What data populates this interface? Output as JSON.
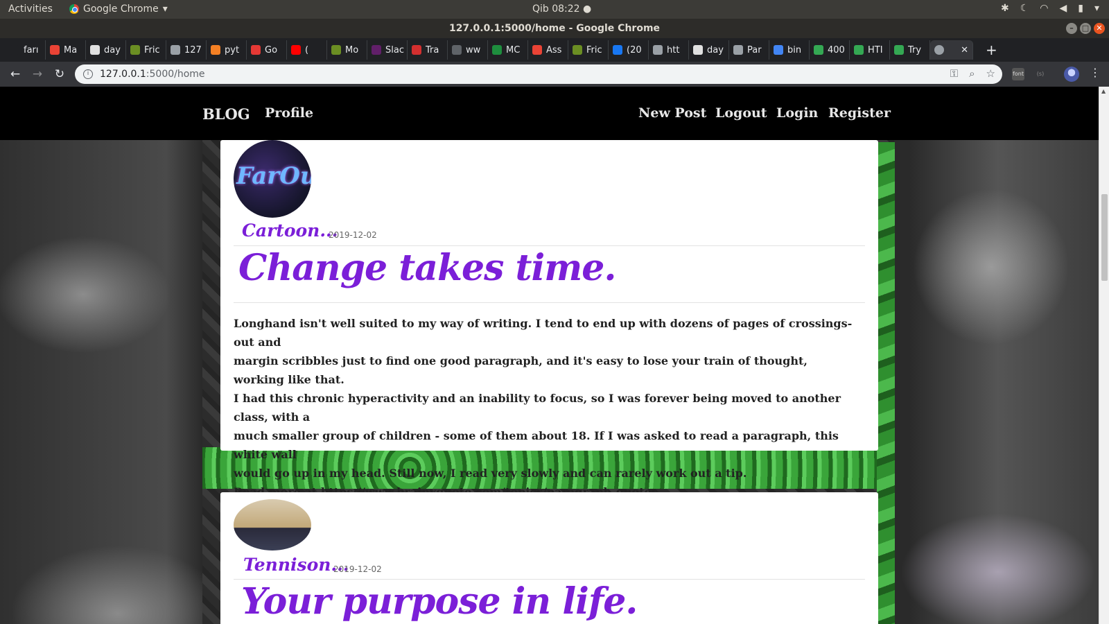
{
  "gnome": {
    "activities": "Activities",
    "app_name": "Google Chrome",
    "clock": "Qib 08:22 ●"
  },
  "window": {
    "title": "127.0.0.1:5000/home - Google Chrome"
  },
  "tabs": [
    {
      "label": "farı",
      "color": "#202124"
    },
    {
      "label": "Ma",
      "color": "#ea4335"
    },
    {
      "label": "day",
      "color": "#e0e0e0"
    },
    {
      "label": "Fric",
      "color": "#6b8e23"
    },
    {
      "label": "127",
      "color": "#9aa0a6"
    },
    {
      "label": "pyt",
      "color": "#f48024"
    },
    {
      "label": "Go",
      "color": "#e53935"
    },
    {
      "label": "(",
      "color": "#ff0000"
    },
    {
      "label": "Mo",
      "color": "#6b8e23"
    },
    {
      "label": "Slac",
      "color": "#611f69"
    },
    {
      "label": "Tra",
      "color": "#d32f2f"
    },
    {
      "label": "ww",
      "color": "#5f6368"
    },
    {
      "label": "MC",
      "color": "#1e8e3e"
    },
    {
      "label": "Ass",
      "color": "#ea4335"
    },
    {
      "label": "Fric",
      "color": "#6b8e23"
    },
    {
      "label": "(20",
      "color": "#1877f2"
    },
    {
      "label": "htt",
      "color": "#9aa0a6"
    },
    {
      "label": "day",
      "color": "#e0e0e0"
    },
    {
      "label": "Par",
      "color": "#9aa0a6"
    },
    {
      "label": "bin",
      "color": "#4285f4"
    },
    {
      "label": "400",
      "color": "#34a853"
    },
    {
      "label": "HTI",
      "color": "#34a853"
    },
    {
      "label": "Try",
      "color": "#34a853"
    }
  ],
  "active_tab": {
    "close": "✕"
  },
  "address": {
    "host": "127.0.0.1",
    "path": ":5000/home"
  },
  "extensions": {
    "font_ext": "font",
    "s_ext": "(s)"
  },
  "site_nav": {
    "brand": "BLOG",
    "profile": "Profile",
    "new_post": "New Post",
    "logout": "Logout",
    "login": "Login",
    "register": "Register"
  },
  "posts": [
    {
      "author": "Cartoon...",
      "date": "2019-12-02",
      "title": "Change takes time.",
      "content_lines": [
        "Longhand isn't well suited to my way of writing. I tend to end up with dozens of pages of crossings-out and",
        "margin scribbles just to find one good paragraph, and it's easy to lose your train of thought, working like that.",
        "I had this chronic hyperactivity and an inability to focus, so I was forever being moved to another class, with a",
        "much smaller group of children - some of them about 18. If I was asked to read a paragraph, this white wall",
        "would go up in my head. Still now, I read very slowly and can rarely work out a tip.",
        "Read more at https://www.brainyquote.com/topics/paragraph-quotes"
      ],
      "avatar_text": "FarOu"
    },
    {
      "author": "Tennison...",
      "date": "2019-12-02",
      "title": "Your purpose in life."
    }
  ]
}
